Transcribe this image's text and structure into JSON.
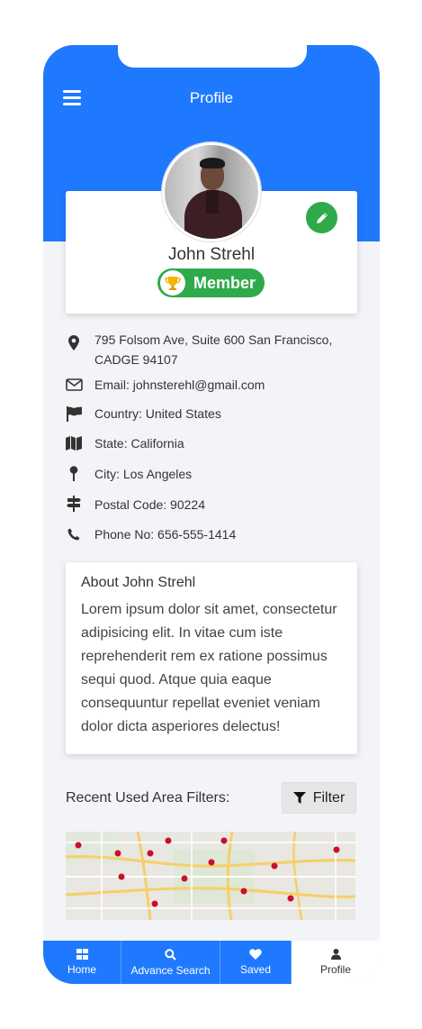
{
  "header": {
    "title": "Profile"
  },
  "profile": {
    "name": "John Strehl",
    "badge": "Member"
  },
  "info": {
    "address_line1": "795 Folsom Ave, Suite 600 San Francisco,",
    "address_line2": "CADGE 94107",
    "email": "Email: johnsterehl@gmail.com",
    "country": "Country: United States",
    "state": "State: California",
    "city": "City: Los Angeles",
    "postal": "Postal Code: 90224",
    "phone": "Phone No: 656-555-1414"
  },
  "about": {
    "title": "About John Strehl",
    "text": "Lorem ipsum dolor sit amet, consectetur adipisicing elit. In vitae cum iste reprehenderit rem ex ratione possimus sequi quod. Atque quia eaque consequuntur repellat eveniet veniam dolor dicta asperiores delectus!"
  },
  "filters": {
    "label": "Recent Used Area Filters:",
    "button": "Filter"
  },
  "nav": {
    "home": "Home",
    "search": "Advance Search",
    "saved": "Saved",
    "profile": "Profile"
  },
  "colors": {
    "primary": "#1f79ff",
    "success": "#2eaa4a",
    "background": "#f3f4f7"
  },
  "icons": [
    "menu-icon",
    "pencil-icon",
    "trophy-icon",
    "map-marker-icon",
    "envelope-icon",
    "flag-icon",
    "map-icon",
    "pin-icon",
    "signpost-icon",
    "phone-icon",
    "filter-icon",
    "grid-icon",
    "search-icon",
    "heart-icon",
    "user-icon"
  ]
}
